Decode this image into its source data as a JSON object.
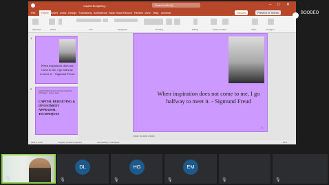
{
  "powerpoint": {
    "doc_title": "Capital Budgeting...",
    "search_placeholder": "Search (Alt+Q)",
    "tabs": [
      "File",
      "Home",
      "Insert",
      "Draw",
      "Design",
      "Transitions",
      "Animations",
      "Slide Show",
      "Record",
      "Review",
      "View",
      "Help",
      "Acrobat"
    ],
    "active_tab": "Home",
    "record_label": "Record",
    "present_label": "Present in Teams",
    "ribbon_groups": [
      "Clipboard",
      "Slides",
      "Font",
      "Paragraph",
      "Drawing",
      "Editing",
      "Adobe Acrobat",
      "Voice",
      "Designer"
    ],
    "thumbnails": [
      {
        "number": "1",
        "text": "When inspiration does not come to me, I go halfway to meet it. - Sigmund Freud"
      },
      {
        "number": "2",
        "small_text": "Capital Budgeting and Investment Appraisal Techniques - Lecture notes",
        "caption": "CAPITAL BUDGETING & INVESTMENT APPRAISAL TECHNIQUES"
      }
    ],
    "main_slide": {
      "quote": "When inspiration does not come to me, I go halfway to meet it. - Sigmund Freud",
      "number": "1"
    },
    "notes_placeholder": "Click to add notes",
    "status_left": "Slide 1 of 29",
    "status_mid": "English (United Kingdom)",
    "status_access": "Accessibility: Investigate",
    "status_zoom": "91%"
  },
  "meeting": {
    "presenter_name": "BOODEO",
    "participants": [
      {
        "initials": "DL"
      },
      {
        "initials": "HG"
      },
      {
        "initials": "EM"
      },
      {
        "initials": ""
      },
      {
        "initials": ""
      }
    ]
  },
  "colors": {
    "ppt_accent": "#b7472a",
    "slide_bg": "#cc99ff",
    "avatar_bg": "#1d5a8c",
    "active_speaker": "#8fd14f"
  }
}
